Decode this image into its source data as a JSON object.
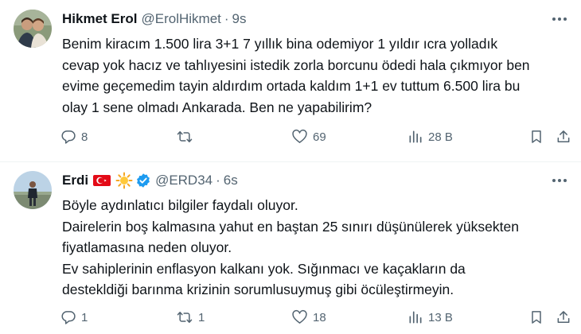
{
  "tweets": [
    {
      "display_name": "Hikmet Erol",
      "handle": "@ErolHikmet",
      "separator": "·",
      "time": "9s",
      "lines": [
        "Benim kiracım 1.500 lira 3+1  7 yıllık bina odemiyor 1 yıldır ıcra yolladık",
        "cevap yok hacız ve tahlıyesini istedik zorla borcunu ödedi hala çıkmıyor ben",
        "evime geçemedim tayin aldırdım ortada kaldım 1+1 ev tuttum 6.500 lira bu",
        "olay 1 sene olmadı Ankarada. Ben ne yapabilirim?"
      ],
      "actions": {
        "replies": "8",
        "retweets": "",
        "likes": "69",
        "views": "28 B"
      }
    },
    {
      "display_name": "Erdi",
      "name_emojis": [
        "turkey-flag-emoji",
        "sun-emoji"
      ],
      "verified": true,
      "handle": "@ERD34",
      "separator": "·",
      "time": "6s",
      "lines": [
        "Böyle aydınlatıcı bilgiler faydalı oluyor.",
        "Dairelerin boş kalmasına yahut en baştan 25 sınırı düşünülerek yüksekten",
        "fiyatlamasına neden oluyor.",
        "Ev sahiplerinin enflasyon kalkanı yok. Sığınmacı ve kaçakların da",
        "destekldiği barınma krizinin sorumlusuymuş gibi öcüleştirmeyin."
      ],
      "actions": {
        "replies": "1",
        "retweets": "1",
        "likes": "18",
        "views": "13 B"
      }
    }
  ],
  "icons": {
    "reply": "speech-bubble-icon",
    "retweet": "retweet-arrows-icon",
    "like": "heart-icon",
    "views": "bar-chart-icon",
    "bookmark": "bookmark-icon",
    "share": "share-upload-icon",
    "more": "more-dots-icon",
    "verified": "verified-badge-icon"
  },
  "colors": {
    "text_primary": "#0f1419",
    "text_secondary": "#536471",
    "verified_blue": "#1d9bf0",
    "divider": "#eff3f4"
  }
}
